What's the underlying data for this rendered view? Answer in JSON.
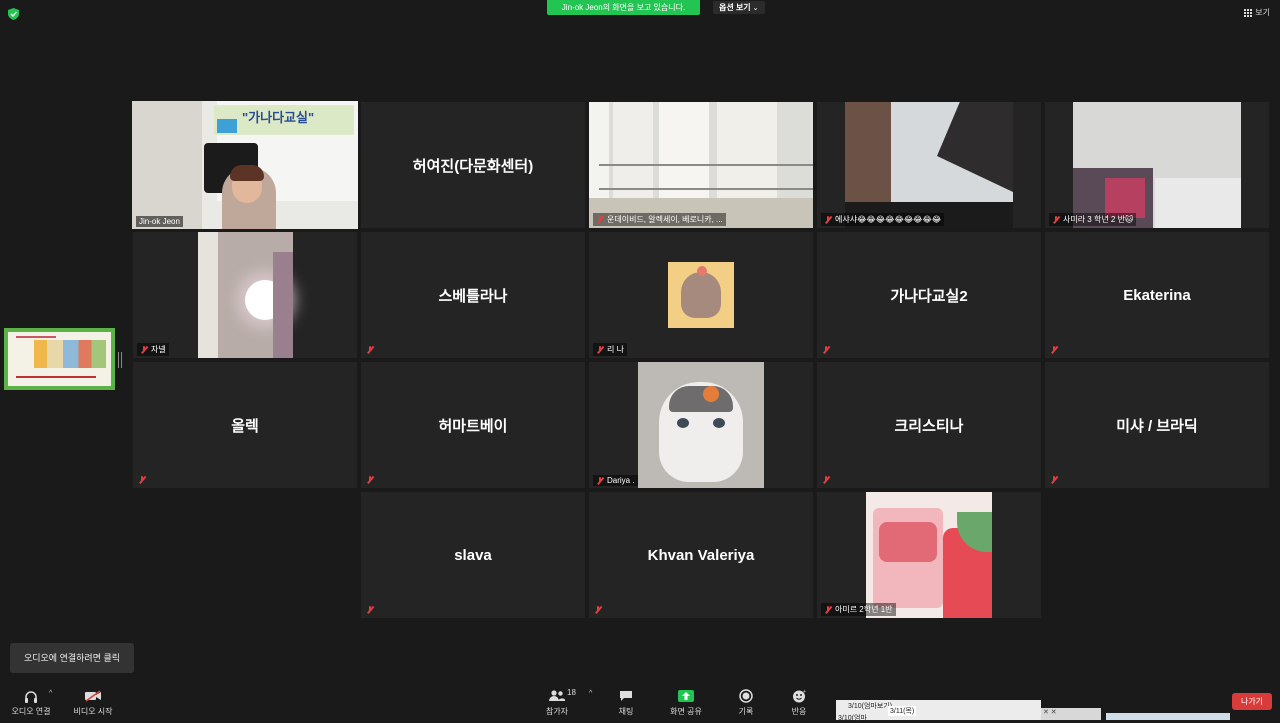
{
  "share_banner": "Jin-ok Jeon의 화면을 보고 있습니다.",
  "options_label": "옵션 보기",
  "view_label": "보기",
  "tiles": [
    {
      "label": "Jin-ok Jeon"
    },
    {
      "name": "허여진(다문화센터)"
    },
    {
      "label": "운데이비드, 알렉세이, 베로니카, ..."
    },
    {
      "label": "에샤샤😂😂😂😂😂😂😂😂😂"
    },
    {
      "label": "사미라 3 학년 2 반🐱"
    },
    {
      "label": "자넬"
    },
    {
      "name": "스베틀라나"
    },
    {
      "label": "리 나"
    },
    {
      "name": "가나다교실2"
    },
    {
      "name": "Ekaterina"
    },
    {
      "name": "올렉"
    },
    {
      "name": "허마트베이"
    },
    {
      "label": "Dariya ."
    },
    {
      "name": "크리스티나"
    },
    {
      "name": "미샤 / 브라딕"
    },
    {
      "name": "slava"
    },
    {
      "name": "Khvan Valeriya"
    },
    {
      "label": "아미르 2학년 1반"
    }
  ],
  "classroom_sign": "\"가나다교실\"",
  "audio_tip": "오디오에 연결하려면 클릭",
  "toolbar": {
    "audio": "오디오 연결",
    "video": "비디오 시작",
    "participants": "참가자",
    "participants_count": "18",
    "chat": "채팅",
    "share": "화면 공유",
    "record": "기록",
    "reactions": "반응",
    "leave": "나가기"
  },
  "calendar_popup": {
    "line1": "3/10(엄마보기)",
    "line2": "3/11(목)",
    "line3": "3/10(엄마"
  },
  "colors": {
    "share_green": "#23c552",
    "active_speaker": "#e9e16d",
    "leave_red": "#d93a3a",
    "mute_red": "#e04040"
  }
}
